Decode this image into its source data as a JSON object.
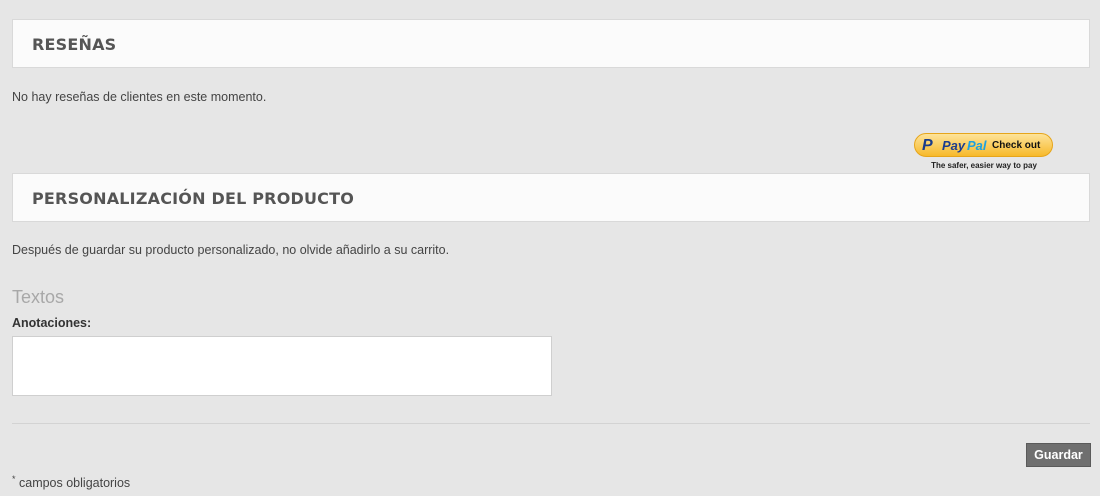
{
  "reviews": {
    "title": "RESEÑAS",
    "empty_text": "No hay reseñas de clientes en este momento."
  },
  "paypal": {
    "icon": "paypal-p-icon",
    "brand_pay": "Pay",
    "brand_pal": "Pal",
    "button_text": "Check out",
    "tagline": "The safer, easier way to pay"
  },
  "customization": {
    "title": "PERSONALIZACIÓN DEL PRODUCTO",
    "note": "Después de guardar su producto personalizado, no olvide añadirlo a su carrito.",
    "texts_label": "Textos",
    "annotations_label": "Anotaciones:",
    "annotations_value": "",
    "save_label": "Guardar",
    "required_marker": "*",
    "required_text": " campos obligatorios"
  },
  "colors": {
    "background": "#e6e6e6",
    "header_bg": "#fbfbfb",
    "save_button": "#6f6f6f"
  }
}
